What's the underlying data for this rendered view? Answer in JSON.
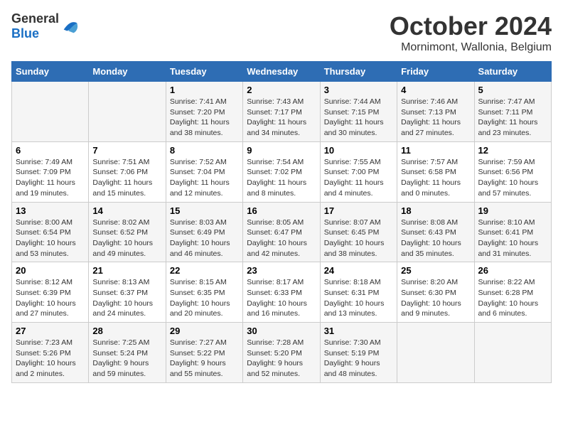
{
  "header": {
    "logo_general": "General",
    "logo_blue": "Blue",
    "month": "October 2024",
    "location": "Mornimont, Wallonia, Belgium"
  },
  "weekdays": [
    "Sunday",
    "Monday",
    "Tuesday",
    "Wednesday",
    "Thursday",
    "Friday",
    "Saturday"
  ],
  "weeks": [
    [
      {
        "day": "",
        "sunrise": "",
        "sunset": "",
        "daylight": ""
      },
      {
        "day": "",
        "sunrise": "",
        "sunset": "",
        "daylight": ""
      },
      {
        "day": "1",
        "sunrise": "Sunrise: 7:41 AM",
        "sunset": "Sunset: 7:20 PM",
        "daylight": "Daylight: 11 hours and 38 minutes."
      },
      {
        "day": "2",
        "sunrise": "Sunrise: 7:43 AM",
        "sunset": "Sunset: 7:17 PM",
        "daylight": "Daylight: 11 hours and 34 minutes."
      },
      {
        "day": "3",
        "sunrise": "Sunrise: 7:44 AM",
        "sunset": "Sunset: 7:15 PM",
        "daylight": "Daylight: 11 hours and 30 minutes."
      },
      {
        "day": "4",
        "sunrise": "Sunrise: 7:46 AM",
        "sunset": "Sunset: 7:13 PM",
        "daylight": "Daylight: 11 hours and 27 minutes."
      },
      {
        "day": "5",
        "sunrise": "Sunrise: 7:47 AM",
        "sunset": "Sunset: 7:11 PM",
        "daylight": "Daylight: 11 hours and 23 minutes."
      }
    ],
    [
      {
        "day": "6",
        "sunrise": "Sunrise: 7:49 AM",
        "sunset": "Sunset: 7:09 PM",
        "daylight": "Daylight: 11 hours and 19 minutes."
      },
      {
        "day": "7",
        "sunrise": "Sunrise: 7:51 AM",
        "sunset": "Sunset: 7:06 PM",
        "daylight": "Daylight: 11 hours and 15 minutes."
      },
      {
        "day": "8",
        "sunrise": "Sunrise: 7:52 AM",
        "sunset": "Sunset: 7:04 PM",
        "daylight": "Daylight: 11 hours and 12 minutes."
      },
      {
        "day": "9",
        "sunrise": "Sunrise: 7:54 AM",
        "sunset": "Sunset: 7:02 PM",
        "daylight": "Daylight: 11 hours and 8 minutes."
      },
      {
        "day": "10",
        "sunrise": "Sunrise: 7:55 AM",
        "sunset": "Sunset: 7:00 PM",
        "daylight": "Daylight: 11 hours and 4 minutes."
      },
      {
        "day": "11",
        "sunrise": "Sunrise: 7:57 AM",
        "sunset": "Sunset: 6:58 PM",
        "daylight": "Daylight: 11 hours and 0 minutes."
      },
      {
        "day": "12",
        "sunrise": "Sunrise: 7:59 AM",
        "sunset": "Sunset: 6:56 PM",
        "daylight": "Daylight: 10 hours and 57 minutes."
      }
    ],
    [
      {
        "day": "13",
        "sunrise": "Sunrise: 8:00 AM",
        "sunset": "Sunset: 6:54 PM",
        "daylight": "Daylight: 10 hours and 53 minutes."
      },
      {
        "day": "14",
        "sunrise": "Sunrise: 8:02 AM",
        "sunset": "Sunset: 6:52 PM",
        "daylight": "Daylight: 10 hours and 49 minutes."
      },
      {
        "day": "15",
        "sunrise": "Sunrise: 8:03 AM",
        "sunset": "Sunset: 6:49 PM",
        "daylight": "Daylight: 10 hours and 46 minutes."
      },
      {
        "day": "16",
        "sunrise": "Sunrise: 8:05 AM",
        "sunset": "Sunset: 6:47 PM",
        "daylight": "Daylight: 10 hours and 42 minutes."
      },
      {
        "day": "17",
        "sunrise": "Sunrise: 8:07 AM",
        "sunset": "Sunset: 6:45 PM",
        "daylight": "Daylight: 10 hours and 38 minutes."
      },
      {
        "day": "18",
        "sunrise": "Sunrise: 8:08 AM",
        "sunset": "Sunset: 6:43 PM",
        "daylight": "Daylight: 10 hours and 35 minutes."
      },
      {
        "day": "19",
        "sunrise": "Sunrise: 8:10 AM",
        "sunset": "Sunset: 6:41 PM",
        "daylight": "Daylight: 10 hours and 31 minutes."
      }
    ],
    [
      {
        "day": "20",
        "sunrise": "Sunrise: 8:12 AM",
        "sunset": "Sunset: 6:39 PM",
        "daylight": "Daylight: 10 hours and 27 minutes."
      },
      {
        "day": "21",
        "sunrise": "Sunrise: 8:13 AM",
        "sunset": "Sunset: 6:37 PM",
        "daylight": "Daylight: 10 hours and 24 minutes."
      },
      {
        "day": "22",
        "sunrise": "Sunrise: 8:15 AM",
        "sunset": "Sunset: 6:35 PM",
        "daylight": "Daylight: 10 hours and 20 minutes."
      },
      {
        "day": "23",
        "sunrise": "Sunrise: 8:17 AM",
        "sunset": "Sunset: 6:33 PM",
        "daylight": "Daylight: 10 hours and 16 minutes."
      },
      {
        "day": "24",
        "sunrise": "Sunrise: 8:18 AM",
        "sunset": "Sunset: 6:31 PM",
        "daylight": "Daylight: 10 hours and 13 minutes."
      },
      {
        "day": "25",
        "sunrise": "Sunrise: 8:20 AM",
        "sunset": "Sunset: 6:30 PM",
        "daylight": "Daylight: 10 hours and 9 minutes."
      },
      {
        "day": "26",
        "sunrise": "Sunrise: 8:22 AM",
        "sunset": "Sunset: 6:28 PM",
        "daylight": "Daylight: 10 hours and 6 minutes."
      }
    ],
    [
      {
        "day": "27",
        "sunrise": "Sunrise: 7:23 AM",
        "sunset": "Sunset: 5:26 PM",
        "daylight": "Daylight: 10 hours and 2 minutes."
      },
      {
        "day": "28",
        "sunrise": "Sunrise: 7:25 AM",
        "sunset": "Sunset: 5:24 PM",
        "daylight": "Daylight: 9 hours and 59 minutes."
      },
      {
        "day": "29",
        "sunrise": "Sunrise: 7:27 AM",
        "sunset": "Sunset: 5:22 PM",
        "daylight": "Daylight: 9 hours and 55 minutes."
      },
      {
        "day": "30",
        "sunrise": "Sunrise: 7:28 AM",
        "sunset": "Sunset: 5:20 PM",
        "daylight": "Daylight: 9 hours and 52 minutes."
      },
      {
        "day": "31",
        "sunrise": "Sunrise: 7:30 AM",
        "sunset": "Sunset: 5:19 PM",
        "daylight": "Daylight: 9 hours and 48 minutes."
      },
      {
        "day": "",
        "sunrise": "",
        "sunset": "",
        "daylight": ""
      },
      {
        "day": "",
        "sunrise": "",
        "sunset": "",
        "daylight": ""
      }
    ]
  ]
}
